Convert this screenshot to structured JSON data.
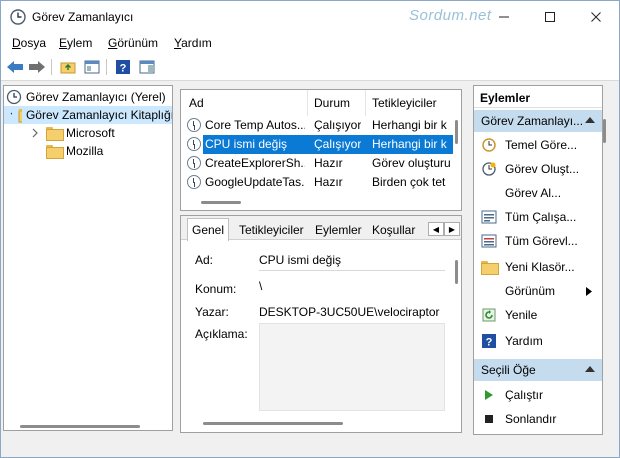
{
  "window": {
    "title": "Görev Zamanlayıcı",
    "watermark": "Sordum.net"
  },
  "menu": {
    "items": [
      {
        "ul": "D",
        "rest": "osya"
      },
      {
        "ul": "E",
        "rest": "ylem"
      },
      {
        "ul": "G",
        "rest": "örünüm"
      },
      {
        "ul": "Y",
        "rest": "ardım"
      }
    ]
  },
  "tree": {
    "root": "Görev Zamanlayıcı (Yerel)",
    "library": "Görev Zamanlayıcı Kitaplığı",
    "children": [
      "Microsoft",
      "Mozilla"
    ]
  },
  "tasks": {
    "columns": [
      "Ad",
      "Durum",
      "Tetikleyiciler"
    ],
    "rows": [
      {
        "name": "Core Temp Autos...",
        "status": "Çalışıyor",
        "trigger": "Herhangi bir k"
      },
      {
        "name": "CPU ismi değiş",
        "status": "Çalışıyor",
        "trigger": "Herhangi bir k"
      },
      {
        "name": "CreateExplorerSh...",
        "status": "Hazır",
        "trigger": "Görev oluşturu"
      },
      {
        "name": "GoogleUpdateTas...",
        "status": "Hazır",
        "trigger": "Birden çok tet"
      }
    ]
  },
  "details": {
    "tabs": [
      "Genel",
      "Tetikleyiciler",
      "Eylemler",
      "Koşullar"
    ],
    "labels": {
      "name": "Ad:",
      "location": "Konum:",
      "author": "Yazar:",
      "description": "Açıklama:"
    },
    "values": {
      "name": "CPU ismi değiş",
      "location": "\\",
      "author": "DESKTOP-3UC50UE\\velociraptor"
    }
  },
  "actions": {
    "header": "Eylemler",
    "section1": "Görev Zamanlayı...",
    "items1": [
      "Temel Göre...",
      "Görev Oluşt...",
      "Görev Al...",
      "Tüm Çalışa...",
      "Tüm Görevl...",
      "Yeni Klasör...",
      "Görünüm",
      "Yenile",
      "Yardım"
    ],
    "section2": "Seçili Öğe",
    "items2": [
      "Çalıştır",
      "Sonlandır"
    ]
  }
}
